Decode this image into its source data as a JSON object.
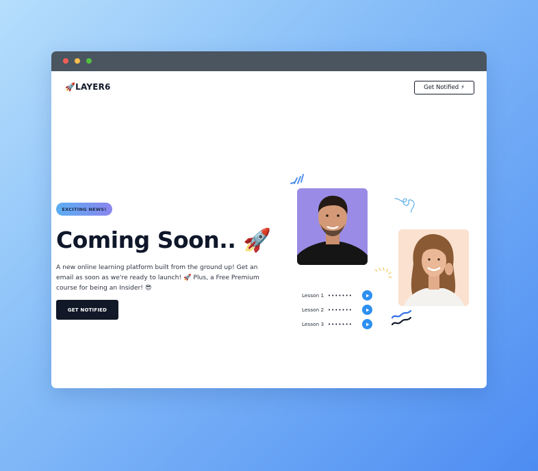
{
  "brand": {
    "logo_text": "🚀LAYER6"
  },
  "nav": {
    "notify_label": "Get Notified ⚡"
  },
  "hero": {
    "badge": "EXCITING NEWS!",
    "headline": "Coming Soon.. 🚀",
    "description": "A new online learning platform built from the ground up! Get an email as soon as we're ready to launch! 🚀 Plus, a Free Premium course for being an Insider! 😎",
    "cta_label": "GET NOTIFIED"
  },
  "lessons": [
    {
      "label": "Lesson 1",
      "dots": "•••••••"
    },
    {
      "label": "Lesson 2",
      "dots": "•••••••"
    },
    {
      "label": "Lesson 3",
      "dots": "•••••••"
    }
  ],
  "colors": {
    "accent_blue": "#2d8ff0",
    "dark": "#111827",
    "badge_gradient_start": "#5aaef3",
    "badge_gradient_end": "#8b85ee"
  }
}
